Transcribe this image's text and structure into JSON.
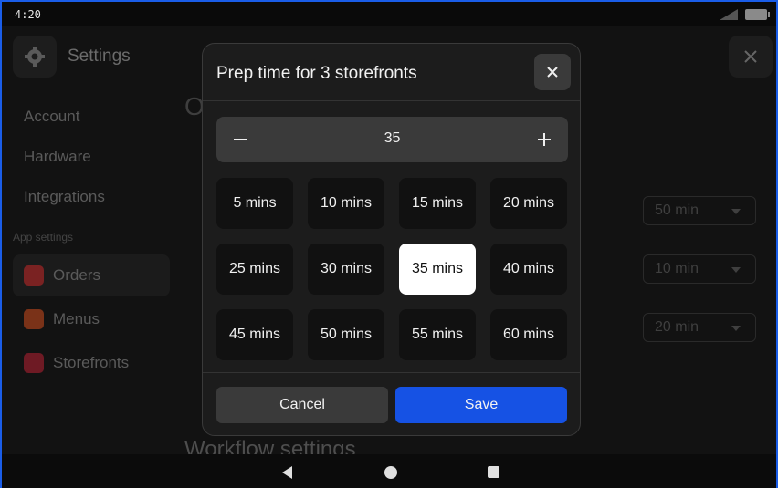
{
  "status_bar": {
    "time": "4:20"
  },
  "background": {
    "title": "Settings",
    "nav": [
      "Account",
      "Hardware",
      "Integrations"
    ],
    "section_label": "App settings",
    "app_items": [
      {
        "label": "Orders",
        "color": "#c93a3a"
      },
      {
        "label": "Menus",
        "color": "#c9542a"
      },
      {
        "label": "Storefronts",
        "color": "#b82b3a"
      }
    ],
    "heading_partial": "O",
    "workflow_heading": "Workflow settings",
    "dropdowns": [
      "50 min",
      "10 min",
      "20 min"
    ]
  },
  "modal": {
    "title": "Prep time for 3 storefronts",
    "stepper_value": "35",
    "options": [
      "5 mins",
      "10 mins",
      "15 mins",
      "20 mins",
      "25 mins",
      "30 mins",
      "35 mins",
      "40 mins",
      "45 mins",
      "50 mins",
      "55 mins",
      "60 mins"
    ],
    "selected_index": 6,
    "cancel_label": "Cancel",
    "save_label": "Save"
  },
  "colors": {
    "accent": "#1652e4",
    "selected_chip": "#ffffff"
  }
}
